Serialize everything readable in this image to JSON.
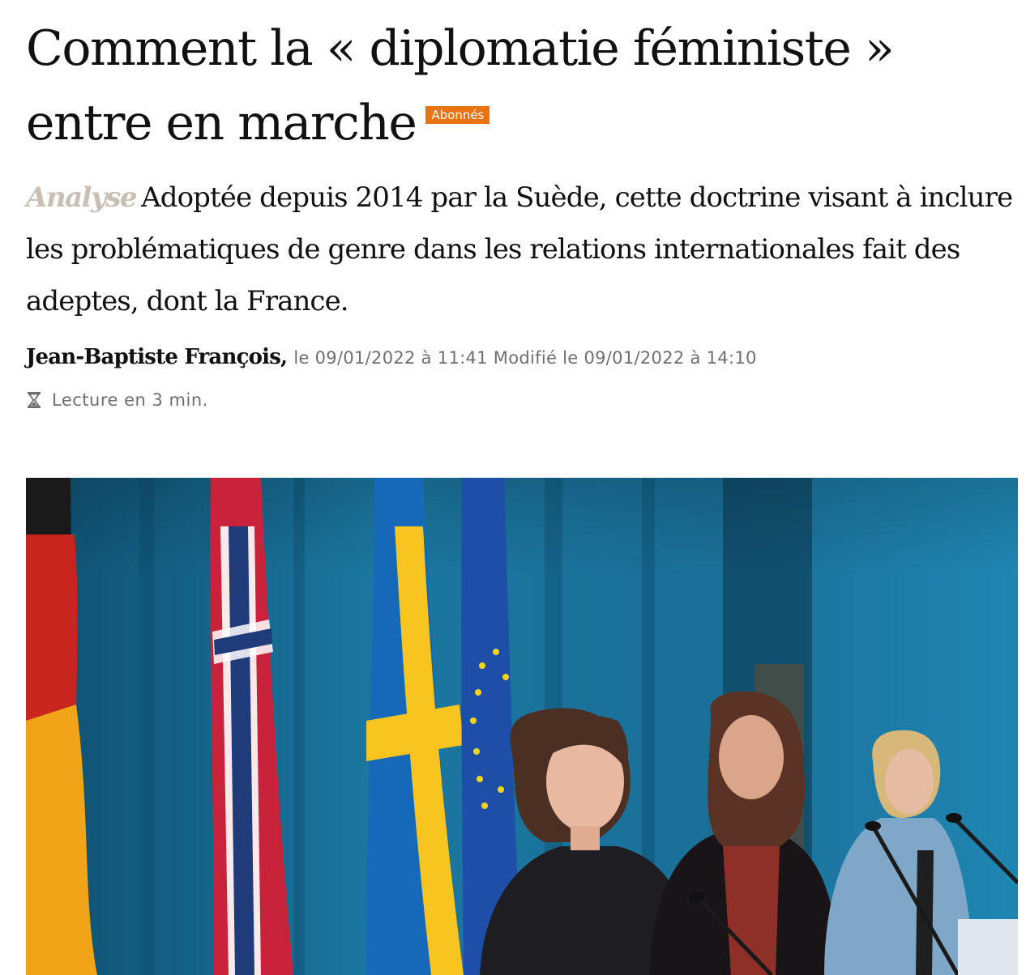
{
  "article": {
    "headline_line1": "Comment la « diplomatie féministe »",
    "headline_line2": "entre en marche",
    "badge": "Abonnés",
    "kicker": "Analyse",
    "dek": "Adoptée depuis 2014 par la Suède, cette doctrine visant à inclure les problématiques de genre dans les relations internationales fait des adeptes, dont la France.",
    "author": "Jean-Baptiste François,",
    "dates": "le 09/01/2022 à 11:41 Modifié le 09/01/2022 à 14:10",
    "reading_time": "Lecture en 3 min.",
    "reading_icon": "hourglass-icon"
  },
  "photo": {
    "subject": "press-conference-photo",
    "background_color": "#1b6e95"
  },
  "colors": {
    "badge": "#e9730e",
    "kicker": "#c9bfb4",
    "meta_text": "#6f6f6f",
    "text": "#111111"
  }
}
